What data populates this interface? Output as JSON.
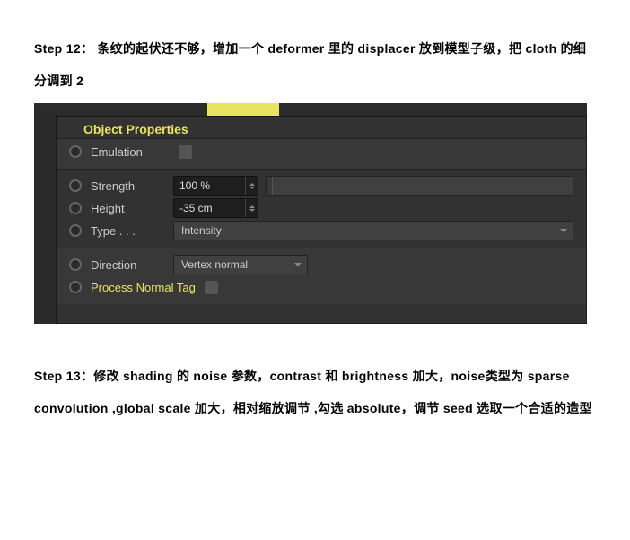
{
  "step12_text": "Step 12： 条纹的起伏还不够，增加一个 deformer 里的 displacer 放到模型子级，把 cloth 的细分调到 2",
  "step13_text": "Step 13：修改 shading 的 noise 参数，contrast 和 brightness 加大，noise类型为 sparse convolution ,global scale 加大，相对缩放调节 ,勾选 absolute，调节 seed 选取一个合适的造型",
  "panel": {
    "title": "Object Properties",
    "emulation": {
      "label": "Emulation",
      "checked": false
    },
    "strength": {
      "label": "Strength",
      "value": "100 %"
    },
    "height": {
      "label": "Height",
      "value": "-35 cm"
    },
    "type": {
      "label": "Type . . .",
      "value": "Intensity"
    },
    "direction": {
      "label": "Direction",
      "value": "Vertex normal"
    },
    "process_normal_tag": {
      "label": "Process Normal Tag",
      "checked": false
    }
  }
}
